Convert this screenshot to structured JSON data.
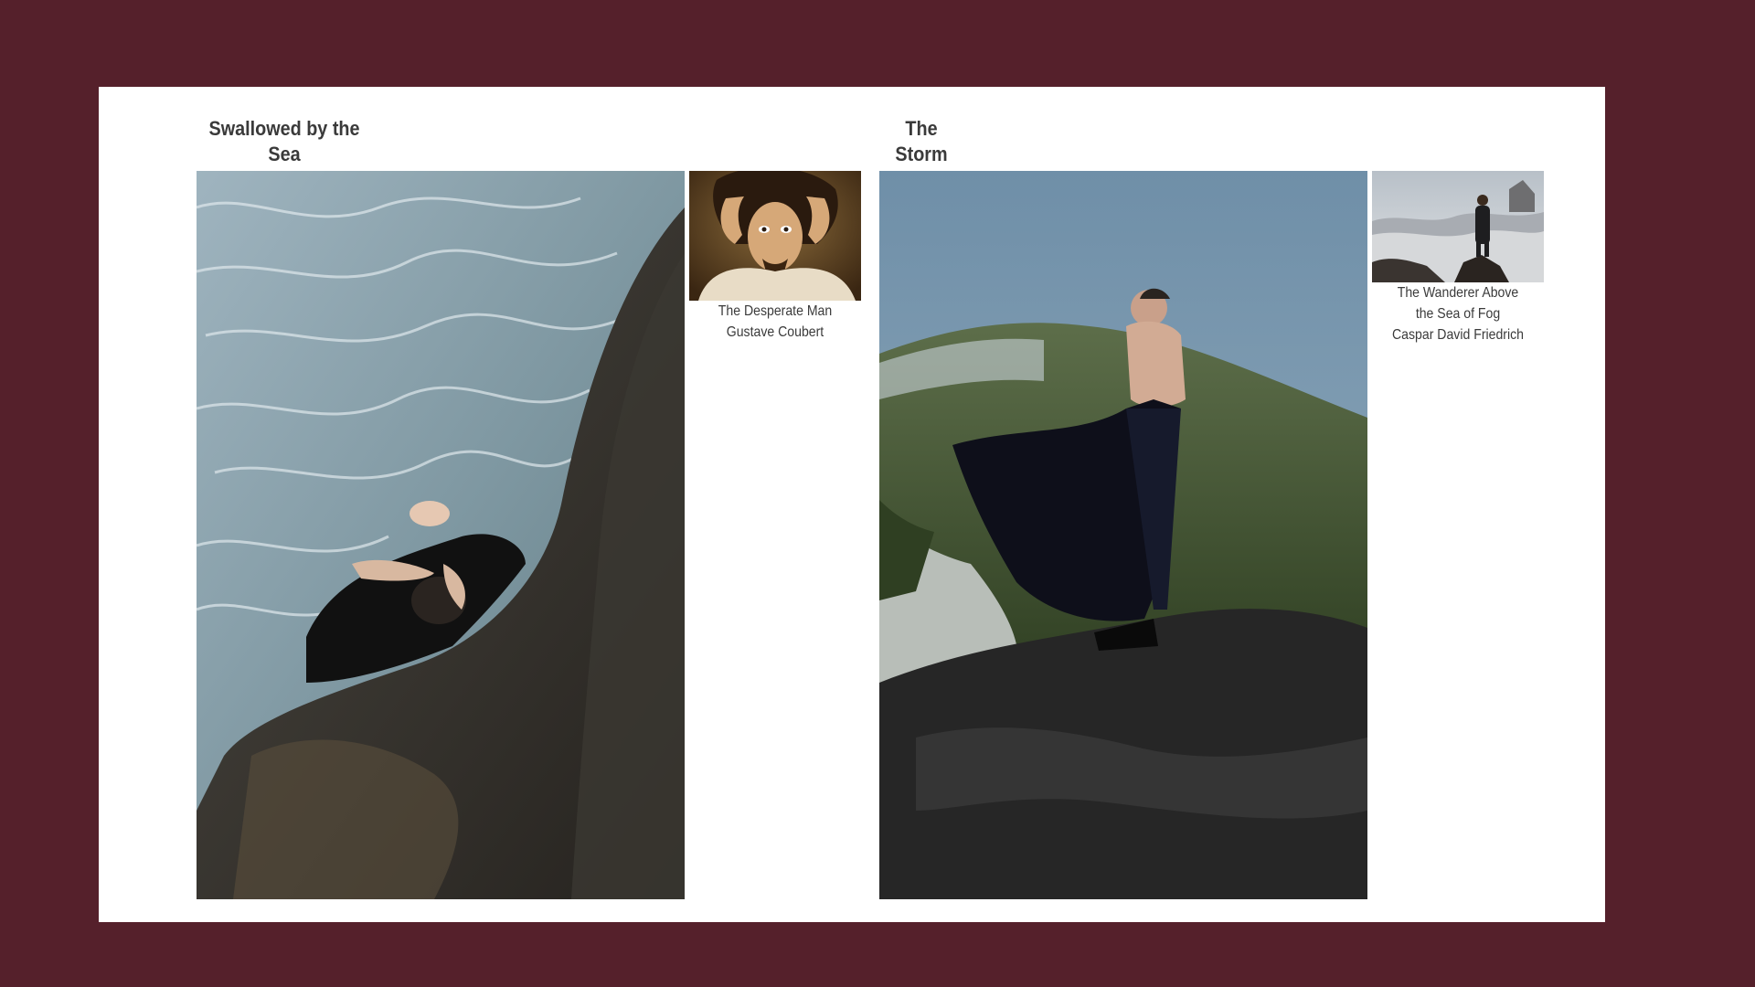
{
  "slide": {
    "background_color": "#55202b",
    "panel_color": "#ffffff"
  },
  "sections": [
    {
      "title_line1": "Swallowed by the",
      "title_line2": "Sea",
      "reference": {
        "caption_line1": "The Desperate Man",
        "caption_line2": "Gustave Coubert"
      }
    },
    {
      "title_line1": "The",
      "title_line2": "Storm",
      "reference": {
        "caption_line1": "The Wanderer Above",
        "caption_line2": "the Sea of Fog",
        "caption_line3": "Caspar David Friedrich"
      }
    }
  ]
}
